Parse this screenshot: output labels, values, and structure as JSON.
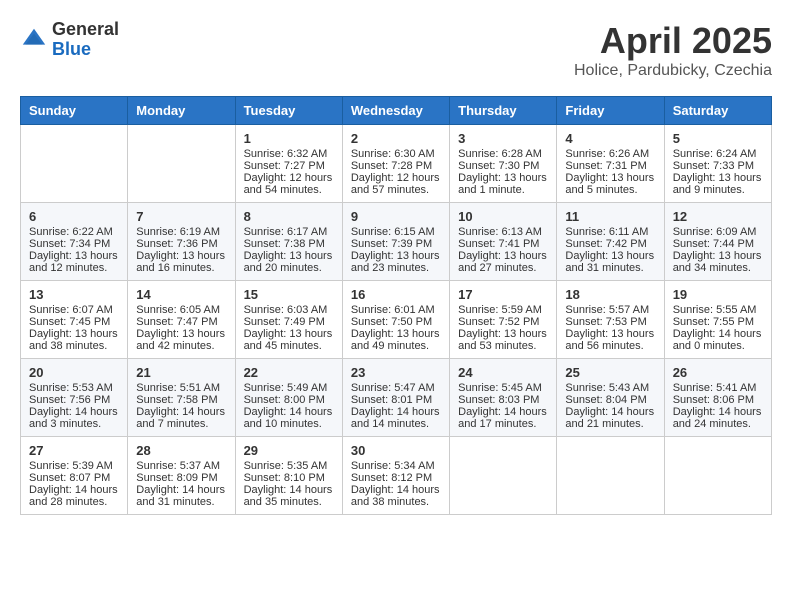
{
  "header": {
    "logo_general": "General",
    "logo_blue": "Blue",
    "month_title": "April 2025",
    "location": "Holice, Pardubicky, Czechia"
  },
  "weekdays": [
    "Sunday",
    "Monday",
    "Tuesday",
    "Wednesday",
    "Thursday",
    "Friday",
    "Saturday"
  ],
  "weeks": [
    [
      {
        "day": "",
        "lines": []
      },
      {
        "day": "",
        "lines": []
      },
      {
        "day": "1",
        "lines": [
          "Sunrise: 6:32 AM",
          "Sunset: 7:27 PM",
          "Daylight: 12 hours",
          "and 54 minutes."
        ]
      },
      {
        "day": "2",
        "lines": [
          "Sunrise: 6:30 AM",
          "Sunset: 7:28 PM",
          "Daylight: 12 hours",
          "and 57 minutes."
        ]
      },
      {
        "day": "3",
        "lines": [
          "Sunrise: 6:28 AM",
          "Sunset: 7:30 PM",
          "Daylight: 13 hours",
          "and 1 minute."
        ]
      },
      {
        "day": "4",
        "lines": [
          "Sunrise: 6:26 AM",
          "Sunset: 7:31 PM",
          "Daylight: 13 hours",
          "and 5 minutes."
        ]
      },
      {
        "day": "5",
        "lines": [
          "Sunrise: 6:24 AM",
          "Sunset: 7:33 PM",
          "Daylight: 13 hours",
          "and 9 minutes."
        ]
      }
    ],
    [
      {
        "day": "6",
        "lines": [
          "Sunrise: 6:22 AM",
          "Sunset: 7:34 PM",
          "Daylight: 13 hours",
          "and 12 minutes."
        ]
      },
      {
        "day": "7",
        "lines": [
          "Sunrise: 6:19 AM",
          "Sunset: 7:36 PM",
          "Daylight: 13 hours",
          "and 16 minutes."
        ]
      },
      {
        "day": "8",
        "lines": [
          "Sunrise: 6:17 AM",
          "Sunset: 7:38 PM",
          "Daylight: 13 hours",
          "and 20 minutes."
        ]
      },
      {
        "day": "9",
        "lines": [
          "Sunrise: 6:15 AM",
          "Sunset: 7:39 PM",
          "Daylight: 13 hours",
          "and 23 minutes."
        ]
      },
      {
        "day": "10",
        "lines": [
          "Sunrise: 6:13 AM",
          "Sunset: 7:41 PM",
          "Daylight: 13 hours",
          "and 27 minutes."
        ]
      },
      {
        "day": "11",
        "lines": [
          "Sunrise: 6:11 AM",
          "Sunset: 7:42 PM",
          "Daylight: 13 hours",
          "and 31 minutes."
        ]
      },
      {
        "day": "12",
        "lines": [
          "Sunrise: 6:09 AM",
          "Sunset: 7:44 PM",
          "Daylight: 13 hours",
          "and 34 minutes."
        ]
      }
    ],
    [
      {
        "day": "13",
        "lines": [
          "Sunrise: 6:07 AM",
          "Sunset: 7:45 PM",
          "Daylight: 13 hours",
          "and 38 minutes."
        ]
      },
      {
        "day": "14",
        "lines": [
          "Sunrise: 6:05 AM",
          "Sunset: 7:47 PM",
          "Daylight: 13 hours",
          "and 42 minutes."
        ]
      },
      {
        "day": "15",
        "lines": [
          "Sunrise: 6:03 AM",
          "Sunset: 7:49 PM",
          "Daylight: 13 hours",
          "and 45 minutes."
        ]
      },
      {
        "day": "16",
        "lines": [
          "Sunrise: 6:01 AM",
          "Sunset: 7:50 PM",
          "Daylight: 13 hours",
          "and 49 minutes."
        ]
      },
      {
        "day": "17",
        "lines": [
          "Sunrise: 5:59 AM",
          "Sunset: 7:52 PM",
          "Daylight: 13 hours",
          "and 53 minutes."
        ]
      },
      {
        "day": "18",
        "lines": [
          "Sunrise: 5:57 AM",
          "Sunset: 7:53 PM",
          "Daylight: 13 hours",
          "and 56 minutes."
        ]
      },
      {
        "day": "19",
        "lines": [
          "Sunrise: 5:55 AM",
          "Sunset: 7:55 PM",
          "Daylight: 14 hours",
          "and 0 minutes."
        ]
      }
    ],
    [
      {
        "day": "20",
        "lines": [
          "Sunrise: 5:53 AM",
          "Sunset: 7:56 PM",
          "Daylight: 14 hours",
          "and 3 minutes."
        ]
      },
      {
        "day": "21",
        "lines": [
          "Sunrise: 5:51 AM",
          "Sunset: 7:58 PM",
          "Daylight: 14 hours",
          "and 7 minutes."
        ]
      },
      {
        "day": "22",
        "lines": [
          "Sunrise: 5:49 AM",
          "Sunset: 8:00 PM",
          "Daylight: 14 hours",
          "and 10 minutes."
        ]
      },
      {
        "day": "23",
        "lines": [
          "Sunrise: 5:47 AM",
          "Sunset: 8:01 PM",
          "Daylight: 14 hours",
          "and 14 minutes."
        ]
      },
      {
        "day": "24",
        "lines": [
          "Sunrise: 5:45 AM",
          "Sunset: 8:03 PM",
          "Daylight: 14 hours",
          "and 17 minutes."
        ]
      },
      {
        "day": "25",
        "lines": [
          "Sunrise: 5:43 AM",
          "Sunset: 8:04 PM",
          "Daylight: 14 hours",
          "and 21 minutes."
        ]
      },
      {
        "day": "26",
        "lines": [
          "Sunrise: 5:41 AM",
          "Sunset: 8:06 PM",
          "Daylight: 14 hours",
          "and 24 minutes."
        ]
      }
    ],
    [
      {
        "day": "27",
        "lines": [
          "Sunrise: 5:39 AM",
          "Sunset: 8:07 PM",
          "Daylight: 14 hours",
          "and 28 minutes."
        ]
      },
      {
        "day": "28",
        "lines": [
          "Sunrise: 5:37 AM",
          "Sunset: 8:09 PM",
          "Daylight: 14 hours",
          "and 31 minutes."
        ]
      },
      {
        "day": "29",
        "lines": [
          "Sunrise: 5:35 AM",
          "Sunset: 8:10 PM",
          "Daylight: 14 hours",
          "and 35 minutes."
        ]
      },
      {
        "day": "30",
        "lines": [
          "Sunrise: 5:34 AM",
          "Sunset: 8:12 PM",
          "Daylight: 14 hours",
          "and 38 minutes."
        ]
      },
      {
        "day": "",
        "lines": []
      },
      {
        "day": "",
        "lines": []
      },
      {
        "day": "",
        "lines": []
      }
    ]
  ]
}
